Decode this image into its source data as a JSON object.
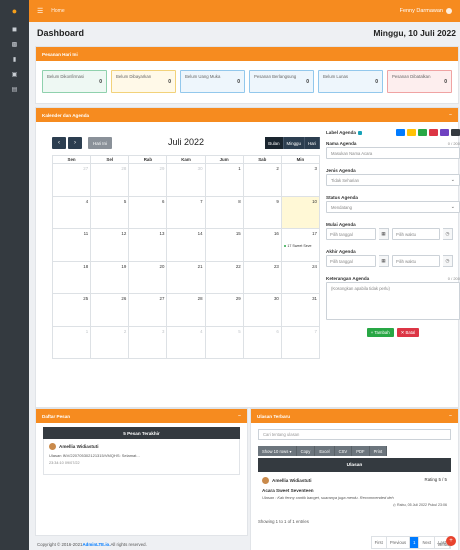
{
  "topbar": {
    "menu_icon": "hamburger-icon",
    "home": "Home",
    "user": "Fenny Darmawan"
  },
  "page": {
    "title": "Dashboard",
    "date": "Minggu, 10 Juli 2022"
  },
  "orders": {
    "title": "Pesanan Hari Ini",
    "items": [
      {
        "label": "Belum Dikonfirmasi",
        "count": "0",
        "bg": "#eef8f3",
        "border": "#8fd1ad"
      },
      {
        "label": "Belum Dibayarkan",
        "count": "0",
        "bg": "#fff9e8",
        "border": "#f2d27a"
      },
      {
        "label": "Belum Uang Muka",
        "count": "0",
        "bg": "#eef6fc",
        "border": "#93c8ec"
      },
      {
        "label": "Pesanan Berlangsung",
        "count": "0",
        "bg": "#eef6fc",
        "border": "#93c8ec"
      },
      {
        "label": "Belum Lunas",
        "count": "0",
        "bg": "#eef6fc",
        "border": "#93c8ec"
      },
      {
        "label": "Pesanan Dibatalkan",
        "count": "0",
        "bg": "#fdeeee",
        "border": "#f0a3a3"
      }
    ]
  },
  "calendar": {
    "title": "Kalender dan Agenda",
    "prev": "‹",
    "next": "›",
    "today": "Hari Ini",
    "month": "Juli 2022",
    "views": [
      "Bulan",
      "Minggu",
      "Hari"
    ],
    "days": [
      "Sen",
      "Sel",
      "Rab",
      "Kam",
      "Jum",
      "Sab",
      "Min"
    ],
    "weeks": [
      [
        {
          "d": "27",
          "o": true
        },
        {
          "d": "28",
          "o": true
        },
        {
          "d": "29",
          "o": true
        },
        {
          "d": "30",
          "o": true
        },
        {
          "d": "1"
        },
        {
          "d": "2"
        },
        {
          "d": "3"
        }
      ],
      [
        {
          "d": "4"
        },
        {
          "d": "5"
        },
        {
          "d": "6"
        },
        {
          "d": "7"
        },
        {
          "d": "8"
        },
        {
          "d": "9"
        },
        {
          "d": "10",
          "t": true
        }
      ],
      [
        {
          "d": "11"
        },
        {
          "d": "12"
        },
        {
          "d": "13"
        },
        {
          "d": "14"
        },
        {
          "d": "15"
        },
        {
          "d": "16"
        },
        {
          "d": "17",
          "e": "17 Sweet Seve"
        }
      ],
      [
        {
          "d": "18"
        },
        {
          "d": "19"
        },
        {
          "d": "20"
        },
        {
          "d": "21"
        },
        {
          "d": "22"
        },
        {
          "d": "23"
        },
        {
          "d": "24"
        }
      ],
      [
        {
          "d": "25"
        },
        {
          "d": "26"
        },
        {
          "d": "27"
        },
        {
          "d": "28"
        },
        {
          "d": "29"
        },
        {
          "d": "30"
        },
        {
          "d": "31"
        }
      ],
      [
        {
          "d": "1",
          "o": true
        },
        {
          "d": "2",
          "o": true
        },
        {
          "d": "3",
          "o": true
        },
        {
          "d": "4",
          "o": true
        },
        {
          "d": "5",
          "o": true
        },
        {
          "d": "6",
          "o": true
        },
        {
          "d": "7",
          "o": true
        }
      ]
    ]
  },
  "agenda": {
    "label_title": "Label Agenda",
    "swatches": [
      "#007bff",
      "#ffc107",
      "#28a745",
      "#dc3545",
      "#6f42c1",
      "#343a40"
    ],
    "name_label": "Nama Agenda",
    "name_counter": "0 / 200",
    "name_placeholder": "Masukan Nama Acara",
    "type_label": "Jenis Agenda",
    "type_value": "Tidak Seharian",
    "status_label": "Status Agenda",
    "status_value": "Mendatang",
    "start_label": "Mulai Agenda",
    "end_label": "Akhir Agenda",
    "date_placeholder": "Pilih tanggal",
    "time_placeholder": "Pilih waktu",
    "desc_label": "Keterangan Agenda",
    "desc_counter": "0 / 200",
    "desc_placeholder": "(Kosongkan apabila tidak perlu)",
    "add": "+ Tambah",
    "cancel": "✕ Batal"
  },
  "messages": {
    "title": "Daftar Pesan",
    "latest": "5 Pesan Terakhir",
    "name": "Amellia Widiastuti",
    "text": "Ulasan INV/220705302121315/VMQHS: Selamat...",
    "time": "23:34:10 09/07/22"
  },
  "reviews": {
    "title": "Ulasan Terbaru",
    "search_placeholder": "Cari tentang ulasan",
    "buttons": [
      "Show 10 rows ▾",
      "Copy",
      "Excel",
      "CSV",
      "PDF",
      "Print"
    ],
    "column": "Ulasan",
    "name": "Amellia Widiastuti",
    "rating": "Rating 5 / 5",
    "review_title": "Acara Sweet Seventeen",
    "review_text": "Ulasan : Kak fenny cantik banget, suaranya juga merdu. Recommended deh",
    "review_date": "Rabu, 05 Juli 2022 Pukul 23:06",
    "info": "Showing 1 to 1 of 1 entries",
    "pages": [
      "First",
      "Previous",
      "1",
      "Next",
      "Last"
    ]
  },
  "footer": {
    "copyright": "Copyright © 2016-2021 ",
    "brand": "AdminLTE.io.",
    "rights": " All rights reserved.",
    "version": "Version"
  }
}
